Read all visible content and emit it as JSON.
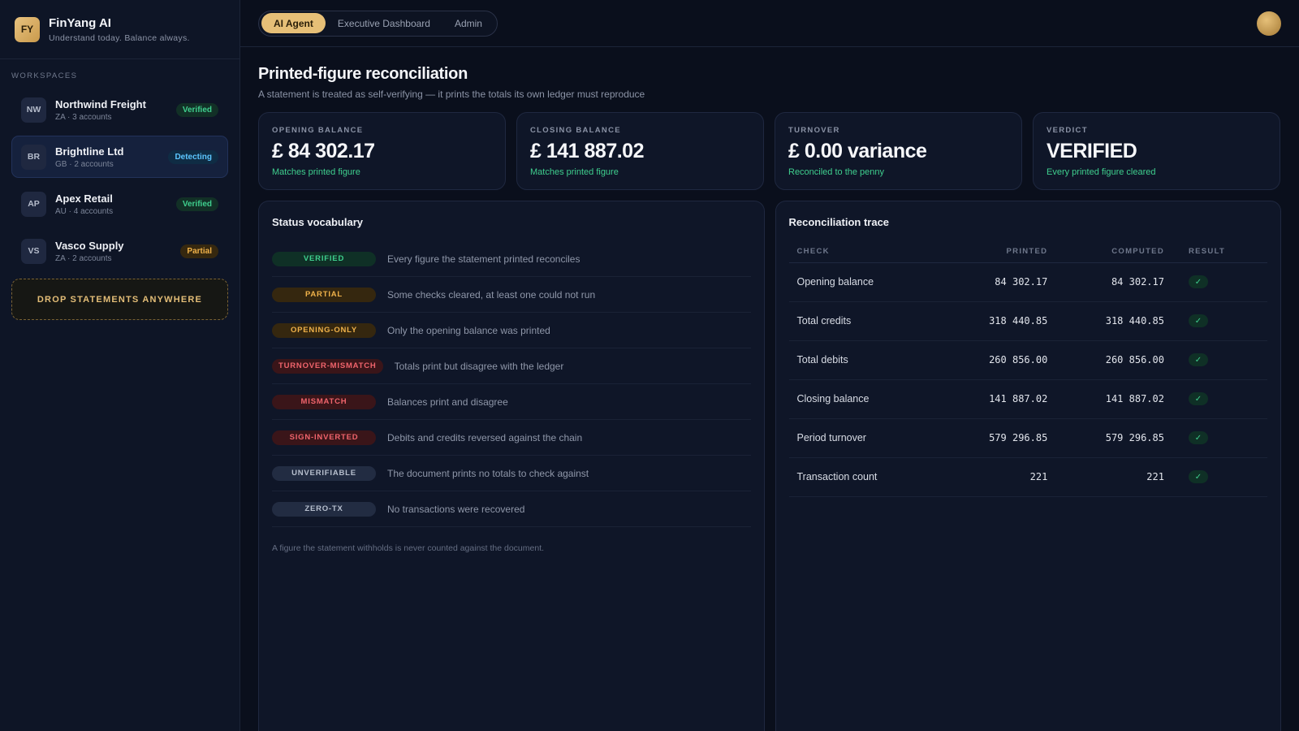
{
  "brand": {
    "logo": "FY",
    "name": "FinYang AI",
    "tagline": "Understand today. Balance always."
  },
  "sidebar": {
    "section_label": "WORKSPACES",
    "workspaces": [
      {
        "initials": "NW",
        "name": "Northwind Freight",
        "meta": "ZA · 3 accounts",
        "badge": "Verified",
        "badge_kind": "verified",
        "active": false
      },
      {
        "initials": "BR",
        "name": "Brightline Ltd",
        "meta": "GB · 2 accounts",
        "badge": "Detecting",
        "badge_kind": "detecting",
        "active": true
      },
      {
        "initials": "AP",
        "name": "Apex Retail",
        "meta": "AU · 4 accounts",
        "badge": "Verified",
        "badge_kind": "verified",
        "active": false
      },
      {
        "initials": "VS",
        "name": "Vasco Supply",
        "meta": "ZA · 2 accounts",
        "badge": "Partial",
        "badge_kind": "partial",
        "active": false
      }
    ],
    "dropzone_label": "DROP STATEMENTS ANYWHERE"
  },
  "topbar": {
    "tabs": [
      {
        "label": "AI Agent",
        "active": true
      },
      {
        "label": "Executive Dashboard",
        "active": false
      },
      {
        "label": "Admin",
        "active": false
      }
    ]
  },
  "page": {
    "title": "Printed-figure reconciliation",
    "subtitle": "A statement is treated as self-verifying — it prints the totals its own ledger must reproduce"
  },
  "kpis": [
    {
      "label": "OPENING BALANCE",
      "value": "£ 84 302.17",
      "note": "Matches printed figure"
    },
    {
      "label": "CLOSING BALANCE",
      "value": "£ 141 887.02",
      "note": "Matches printed figure"
    },
    {
      "label": "TURNOVER",
      "value": "£ 0.00 variance",
      "note": "Reconciled to the penny"
    },
    {
      "label": "VERDICT",
      "value": "VERIFIED",
      "note": "Every printed figure cleared"
    }
  ],
  "vocab": {
    "title": "Status vocabulary",
    "items": [
      {
        "status": "VERIFIED",
        "tone": "green",
        "desc": "Every figure the statement printed reconciles"
      },
      {
        "status": "PARTIAL",
        "tone": "amber",
        "desc": "Some checks cleared, at least one could not run"
      },
      {
        "status": "OPENING-ONLY",
        "tone": "amber",
        "desc": "Only the opening balance was printed"
      },
      {
        "status": "TURNOVER-MISMATCH",
        "tone": "red",
        "desc": "Totals print but disagree with the ledger"
      },
      {
        "status": "MISMATCH",
        "tone": "red",
        "desc": "Balances print and disagree"
      },
      {
        "status": "SIGN-INVERTED",
        "tone": "red",
        "desc": "Debits and credits reversed against the chain"
      },
      {
        "status": "UNVERIFIABLE",
        "tone": "slate",
        "desc": "The document prints no totals to check against"
      },
      {
        "status": "ZERO-TX",
        "tone": "slate",
        "desc": "No transactions were recovered"
      }
    ],
    "footnote": "A figure the statement withholds is never counted against the document."
  },
  "trace": {
    "title": "Reconciliation trace",
    "columns": [
      "CHECK",
      "PRINTED",
      "COMPUTED",
      "RESULT"
    ],
    "rows": [
      {
        "check": "Opening balance",
        "printed": "84 302.17",
        "computed": "84 302.17",
        "result": "✓"
      },
      {
        "check": "Total credits",
        "printed": "318 440.85",
        "computed": "318 440.85",
        "result": "✓"
      },
      {
        "check": "Total debits",
        "printed": "260 856.00",
        "computed": "260 856.00",
        "result": "✓"
      },
      {
        "check": "Closing balance",
        "printed": "141 887.02",
        "computed": "141 887.02",
        "result": "✓"
      },
      {
        "check": "Period turnover",
        "printed": "579 296.85",
        "computed": "579 296.85",
        "result": "✓"
      },
      {
        "check": "Transaction count",
        "printed": "221",
        "computed": "221",
        "result": "✓"
      }
    ]
  }
}
